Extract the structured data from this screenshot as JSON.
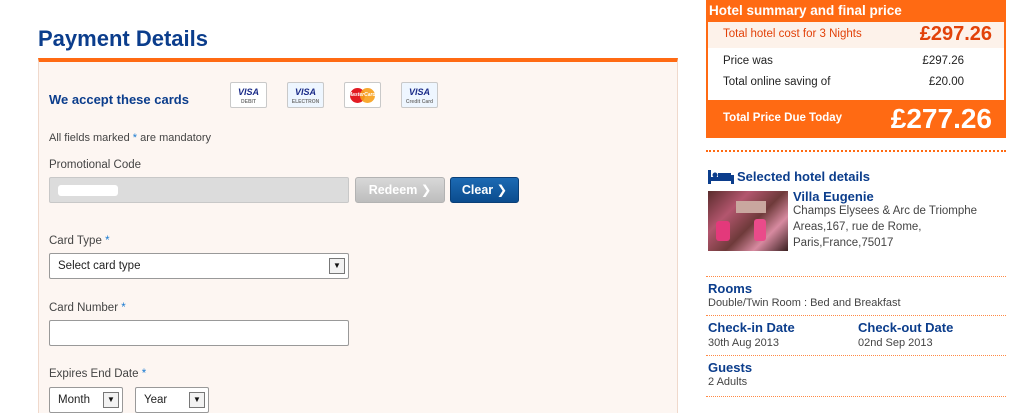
{
  "payment": {
    "title": "Payment Details",
    "cards_title": "We accept these cards",
    "cards": [
      {
        "name": "visa-debit-icon",
        "label": "VISA",
        "sub": "DEBIT"
      },
      {
        "name": "visa-electron-icon",
        "label": "VISA",
        "sub": "ELECTRON"
      },
      {
        "name": "mastercard-icon",
        "label": "MasterCard"
      },
      {
        "name": "visa-credit-icon",
        "label": "VISA",
        "sub": "Credit Card"
      }
    ],
    "mandatory_prefix": "All fields marked",
    "mandatory_star": "*",
    "mandatory_suffix": "are mandatory",
    "promo_label": "Promotional Code",
    "redeem_label": "Redeem",
    "clear_label": "Clear",
    "card_type_label": "Card Type",
    "card_type_value": "Select card type",
    "card_number_label": "Card Number",
    "expires_label": "Expires End Date",
    "month_value": "Month",
    "year_value": "Year"
  },
  "summary": {
    "title": "Hotel summary and final price",
    "cost_label": "Total hotel cost for 3  Nights",
    "cost_value": "£297.26",
    "price_was_label": "Price was",
    "price_was_value": "£297.26",
    "saving_label": "Total online saving of",
    "saving_value": "£20.00",
    "total_label": "Total Price Due Today",
    "total_value": "£277.26"
  },
  "hotel": {
    "section_title": "Selected hotel details",
    "name": "Villa Eugenie",
    "address": [
      "Champs Elysees & Arc de Triomphe",
      "Areas,167, rue de Rome,",
      "Paris,France,75017"
    ]
  },
  "details": {
    "rooms_title": "Rooms",
    "rooms_value": "Double/Twin Room : Bed and Breakfast",
    "checkin_title": "Check-in Date",
    "checkin_value": "30th Aug 2013",
    "checkout_title": "Check-out Date",
    "checkout_value": "02nd Sep 2013",
    "guests_title": "Guests",
    "guests_value": "2 Adults"
  },
  "colors": {
    "accent": "#ff6a13",
    "heading": "#0b3d8c",
    "clear_button": "#0b4c8e"
  }
}
